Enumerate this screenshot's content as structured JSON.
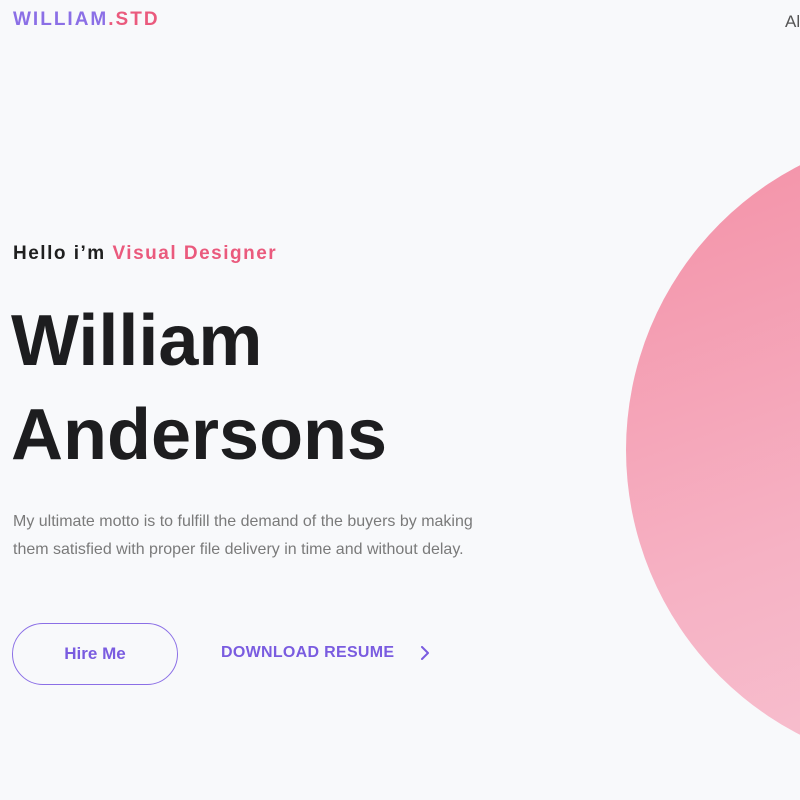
{
  "header": {
    "logo_name": "WILLIAM",
    "logo_suffix": ".STD",
    "nav_item": "Al"
  },
  "hero": {
    "greeting_prefix": "Hello i’m ",
    "greeting_role": "Visual Designer",
    "name_line1": "William",
    "name_line2": "Andersons",
    "motto": "My ultimate motto is to fulfill the demand of the buyers by making them satisfied with proper file delivery in time and without delay.",
    "hire_button_label": "Hire Me",
    "download_label": "DOWNLOAD RESUME",
    "download_icon": "chevron-right-icon"
  },
  "colors": {
    "brand_purple": "#8b6fe6",
    "accent_pink": "#ea5a7d",
    "background": "#f8f9fb",
    "circle_gradient": [
      "#f38fa5",
      "#f6b2c4",
      "#f8c8d6"
    ]
  }
}
